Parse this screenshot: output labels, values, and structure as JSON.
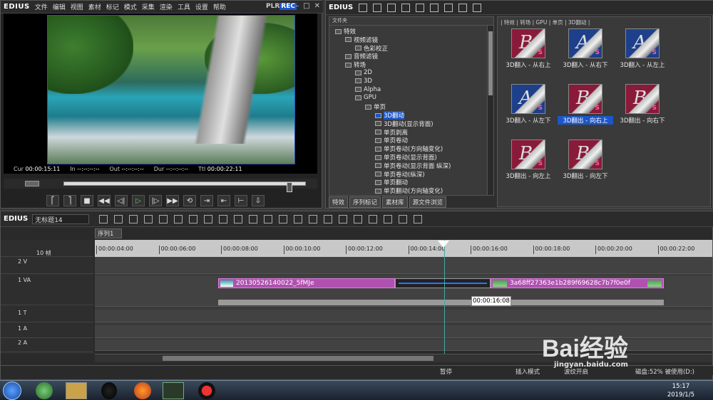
{
  "app": {
    "logo": "EDIUS",
    "menu": [
      "文件",
      "编辑",
      "视图",
      "素材",
      "标记",
      "模式",
      "采集",
      "渲染",
      "工具",
      "设置",
      "帮助"
    ],
    "plr": "PLR",
    "rec": "REC"
  },
  "player": {
    "cur_label": "Cur",
    "cur": "00:00:15:11",
    "in_label": "In",
    "in": "--:--:--:--",
    "out_label": "Out",
    "out": "--:--:--:--",
    "dur_label": "Dur",
    "dur": "--:--:--:--",
    "ttl_label": "Ttl",
    "ttl": "00:00:22:11"
  },
  "effects": {
    "logo": "EDIUS",
    "tree_header": "文件夹",
    "tree": [
      {
        "label": "特效",
        "depth": 0
      },
      {
        "label": "视频滤镜",
        "depth": 1
      },
      {
        "label": "色彩校正",
        "depth": 2
      },
      {
        "label": "音频滤镜",
        "depth": 1
      },
      {
        "label": "转场",
        "depth": 1
      },
      {
        "label": "2D",
        "depth": 2
      },
      {
        "label": "3D",
        "depth": 2
      },
      {
        "label": "Alpha",
        "depth": 2
      },
      {
        "label": "GPU",
        "depth": 2
      },
      {
        "label": "单页",
        "depth": 3
      },
      {
        "label": "3D翻动",
        "depth": 4,
        "selected": true
      },
      {
        "label": "3D翻动(显示背面)",
        "depth": 4
      },
      {
        "label": "单页剥离",
        "depth": 4
      },
      {
        "label": "单页卷动",
        "depth": 4
      },
      {
        "label": "单页卷动(方向轴变化)",
        "depth": 4
      },
      {
        "label": "单页卷动(显示背面)",
        "depth": 4
      },
      {
        "label": "单页卷动(显示背面 纵深)",
        "depth": 4
      },
      {
        "label": "单页卷动(纵深)",
        "depth": 4
      },
      {
        "label": "单页翻动",
        "depth": 4
      },
      {
        "label": "单页翻动(方向轴变化)",
        "depth": 4
      }
    ],
    "tabs": [
      "特效",
      "序列标记",
      "素材库",
      "源文件浏览"
    ],
    "path": "| 特效 | 转场 | GPU | 单页 | 3D翻动 |",
    "thumbs": [
      {
        "label": "3D翻入 - 从右上",
        "letter": "B",
        "blue": false
      },
      {
        "label": "3D翻入 - 从右下",
        "letter": "A",
        "blue": true
      },
      {
        "label": "3D翻入 - 从左上",
        "letter": "A",
        "blue": true
      },
      {
        "label": "3D翻入 - 从左下",
        "letter": "A",
        "blue": true
      },
      {
        "label": "3D翻出 - 向右上",
        "letter": "B",
        "blue": false,
        "selected": true
      },
      {
        "label": "3D翻出 - 向右下",
        "letter": "B",
        "blue": false
      },
      {
        "label": "3D翻出 - 向左上",
        "letter": "B",
        "blue": false
      },
      {
        "label": "3D翻出 - 向左下",
        "letter": "B",
        "blue": false
      }
    ]
  },
  "timeline": {
    "logo": "EDIUS",
    "project": "无标题14",
    "sequence_tab": "序列1",
    "zoom": "10 帧",
    "ruler": [
      "00:00:04:00",
      "00:00:06:00",
      "00:00:08:00",
      "00:00:10:00",
      "00:00:12:00",
      "00:00:14:00",
      "00:00:16:00",
      "00:00:18:00",
      "00:00:20:00",
      "00:00:22:00"
    ],
    "tracks": [
      "2 V",
      "1 VA",
      "1 T",
      "1 A",
      "2 A"
    ],
    "clip1": "20130526140022_5fMJe",
    "clip2": "3a68ff27363e1b289f69628c7b7f0e0f",
    "tooltip": "00:00:16:08",
    "status": {
      "pause": "暂停",
      "mode": "插入模式",
      "ripple": "波纹开启",
      "disk": "磁盘:52% 被使用(D:)"
    }
  },
  "taskbar": {
    "time": "15:17",
    "date": "2019/1/5"
  },
  "watermark": {
    "brand": "Bai经验",
    "url": "jingyan.baidu.com"
  }
}
